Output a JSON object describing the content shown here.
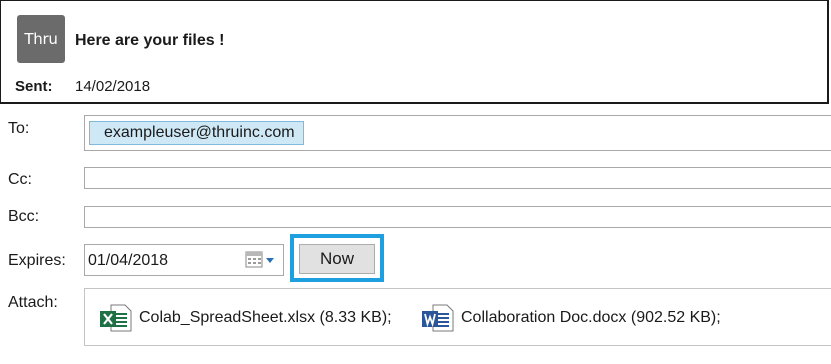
{
  "header": {
    "logo_text": "Thru",
    "subject": "Here are your files !",
    "sent_label": "Sent:",
    "sent_value": "14/02/2018"
  },
  "form": {
    "to_label": "To:",
    "to_recipients": [
      "exampleuser@thruinc.com"
    ],
    "cc_label": "Cc:",
    "cc_value": "",
    "bcc_label": "Bcc:",
    "bcc_value": "",
    "expires_label": "Expires:",
    "expires_value": "01/04/2018",
    "now_button": "Now",
    "attach_label": "Attach:",
    "attachments": [
      {
        "name": "Colab_SpreadSheet.xlsx (8.33 KB);",
        "icon": "excel-file-icon"
      },
      {
        "name": "Collaboration Doc.docx (902.52 KB);",
        "icon": "word-file-icon"
      }
    ]
  },
  "colors": {
    "highlight": "#1ea0e0",
    "chip_bg": "#cfe8f6",
    "excel_green": "#1e7145",
    "word_blue": "#2b579a"
  }
}
